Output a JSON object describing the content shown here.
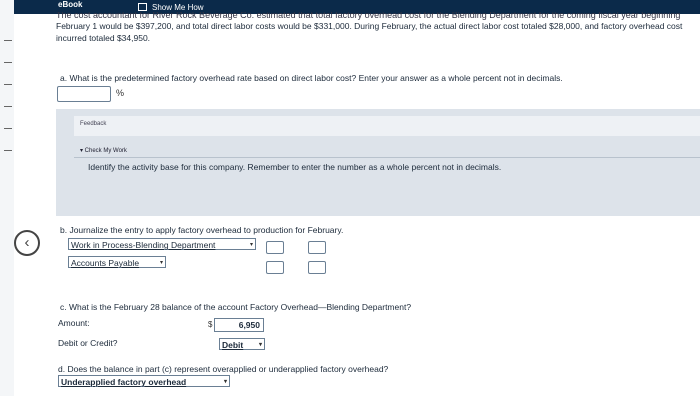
{
  "header": {
    "ebook_label": "eBook",
    "show_me_how_label": "Show Me How"
  },
  "problem": {
    "cut_line": "The cost accountant for River Rock Beverage Co. estimated that total factory overhead cost for the Blending Department for the coming fiscal year beginning",
    "text": "February 1 would be $397,200, and total direct labor costs would be $331,000. During February, the actual direct labor cost totaled $28,000, and factory overhead cost incurred totaled $34,950."
  },
  "part_a": {
    "question": "a. What is the predetermined factory overhead rate based on direct labor cost? Enter your answer as a whole percent not in decimals.",
    "input_value": "",
    "unit": "%"
  },
  "feedback": {
    "label": "Feedback",
    "check_label": "▾ Check My Work",
    "check_text": "Identify the activity base for this company. Remember to enter the number as a whole percent not in decimals."
  },
  "part_b": {
    "question": "b. Journalize the entry to apply factory overhead to production for February.",
    "debit_account": "Work in Process-Blending Department",
    "credit_account": "Accounts Payable"
  },
  "part_c": {
    "question": "c. What is the February 28 balance of the account Factory Overhead—Blending Department?",
    "amount_label": "Amount:",
    "currency": "$",
    "amount_value": "6,950",
    "debit_credit_label": "Debit or Credit?",
    "debit_credit_value": "Debit"
  },
  "part_d": {
    "question": "d. Does the balance in part (c) represent overapplied or underapplied factory overhead?",
    "answer": "Underapplied factory overhead"
  },
  "icons": {
    "back": "‹",
    "dropdown": "▾"
  }
}
